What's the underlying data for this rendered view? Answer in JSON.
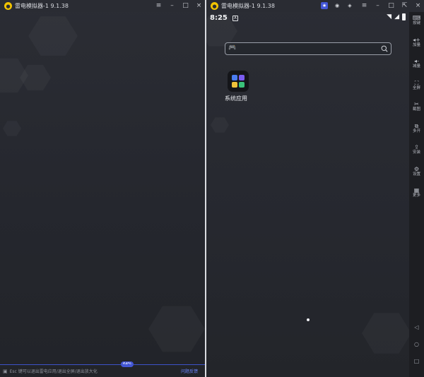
{
  "left_window": {
    "title": "雷电模拟器-1 9.1.38",
    "controls": {
      "menu": "≡",
      "minimize": "–",
      "maximize": "□",
      "close": "×"
    },
    "status": {
      "icon": "info-icon",
      "message": "Esc 键可以退出雷电应用/退出全屏/退出放大化",
      "link": "问题反馈",
      "progress_label": "64%"
    }
  },
  "right_window": {
    "title": "雷电模拟器-1 9.1.38",
    "controls": {
      "menu": "≡",
      "minimize": "–",
      "maximize": "□",
      "expand": "⇱",
      "close": "×"
    },
    "android": {
      "time": "8:25",
      "search": {
        "value": "",
        "placeholder": ""
      },
      "folder": {
        "label": "系统应用",
        "colors": [
          "#4a7cf0",
          "#7b5cf0",
          "#f0c23a",
          "#3ac27a"
        ]
      }
    },
    "sidebar": {
      "items": [
        {
          "icon": "keyboard-icon",
          "glyph": "⌨",
          "label": "按键"
        },
        {
          "icon": "volume-up-icon",
          "glyph": "◂+",
          "label": "加量"
        },
        {
          "icon": "volume-down-icon",
          "glyph": "◂-",
          "label": "减量"
        },
        {
          "icon": "fullscreen-icon",
          "glyph": "⛶",
          "label": "全屏"
        },
        {
          "icon": "screenshot-icon",
          "glyph": "✂",
          "label": "截图"
        },
        {
          "icon": "multi-instance-icon",
          "glyph": "⧉",
          "label": "多开"
        },
        {
          "icon": "install-icon",
          "glyph": "⇪",
          "label": "安装"
        },
        {
          "icon": "settings-icon",
          "glyph": "⚙",
          "label": "设置"
        },
        {
          "icon": "more-icon",
          "glyph": "▦",
          "label": "更多"
        }
      ],
      "nav": [
        {
          "icon": "back-icon",
          "glyph": "◁"
        },
        {
          "icon": "home-icon",
          "glyph": "○"
        },
        {
          "icon": "recents-icon",
          "glyph": "□"
        }
      ]
    }
  },
  "colors": {
    "accent": "#4457d8",
    "logo": "#f2c400",
    "background": "#25272e"
  }
}
